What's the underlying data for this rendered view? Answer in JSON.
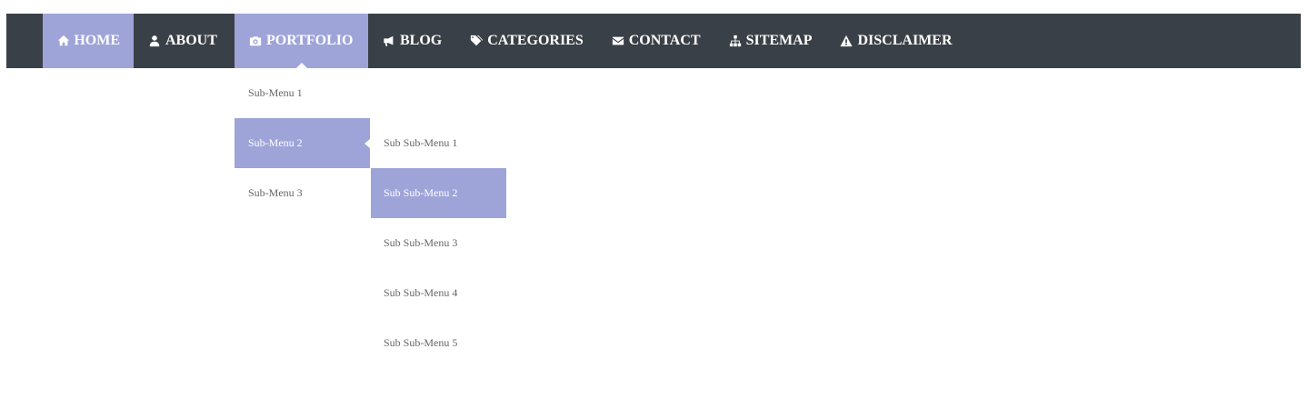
{
  "nav": {
    "items": [
      {
        "label": "HOME",
        "icon": "home-icon"
      },
      {
        "label": "ABOUT",
        "icon": "user-icon"
      },
      {
        "label": "PORTFOLIO",
        "icon": "camera-icon"
      },
      {
        "label": "BLOG",
        "icon": "bullhorn-icon"
      },
      {
        "label": "CATEGORIES",
        "icon": "tags-icon"
      },
      {
        "label": "CONTACT",
        "icon": "envelope-icon"
      },
      {
        "label": "SITEMAP",
        "icon": "sitemap-icon"
      },
      {
        "label": "DISCLAIMER",
        "icon": "warning-icon"
      }
    ]
  },
  "submenu": {
    "items": [
      {
        "label": "Sub-Menu 1"
      },
      {
        "label": "Sub-Menu 2"
      },
      {
        "label": "Sub-Menu 3"
      }
    ]
  },
  "subsubmenu": {
    "items": [
      {
        "label": "Sub Sub-Menu 1"
      },
      {
        "label": "Sub Sub-Menu 2"
      },
      {
        "label": "Sub Sub-Menu 3"
      },
      {
        "label": "Sub Sub-Menu 4"
      },
      {
        "label": "Sub Sub-Menu 5"
      }
    ]
  },
  "colors": {
    "navbar_bg": "#3a4047",
    "accent": "#9ea4d8",
    "submenu_text": "#666666"
  }
}
